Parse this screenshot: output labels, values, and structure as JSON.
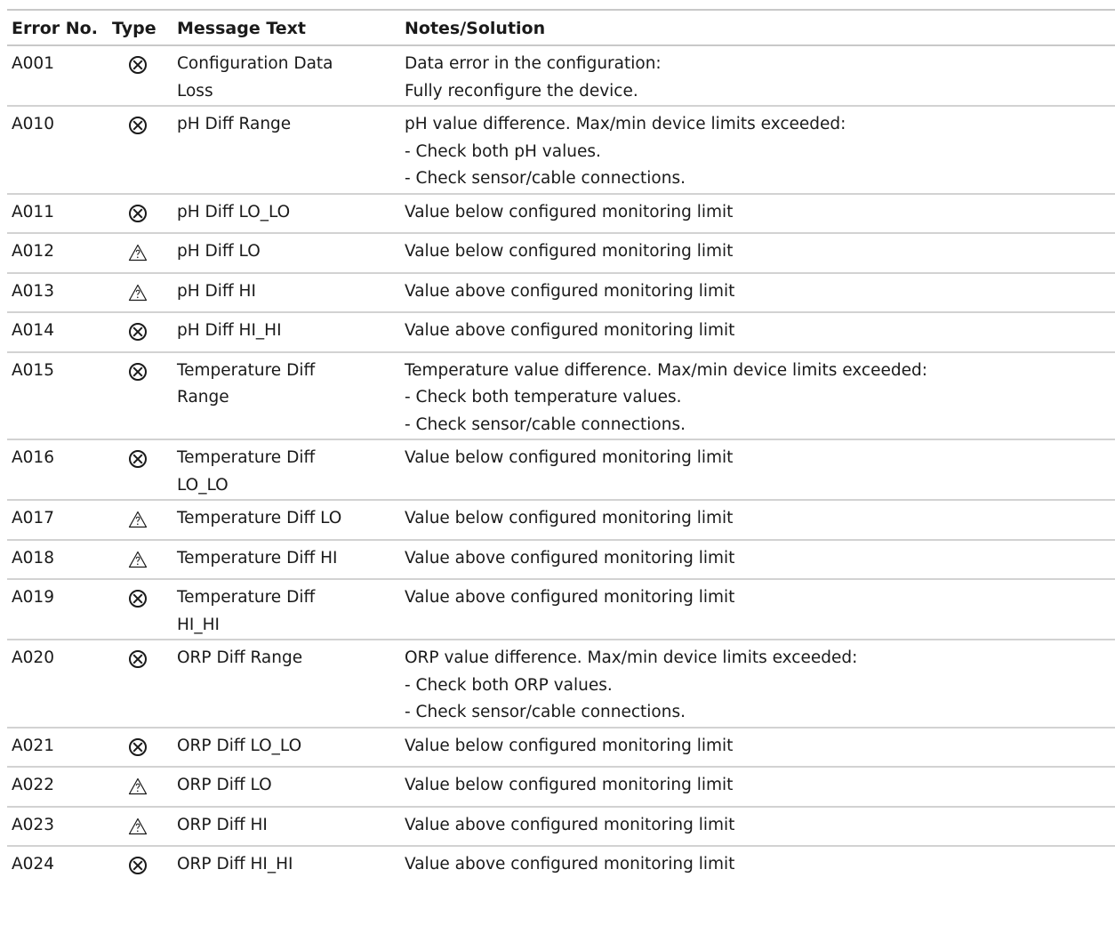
{
  "table": {
    "headers": {
      "error_no": "Error No.",
      "type": "Type",
      "message": "Message Text",
      "notes": "Notes/Solution"
    },
    "rows": [
      {
        "error_no": "A001",
        "type": "failure-icon",
        "message": [
          "Configuration Data",
          "Loss"
        ],
        "notes": [
          "Data error in the configuration:",
          "Fully reconfigure the device."
        ]
      },
      {
        "error_no": "A010",
        "type": "failure-icon",
        "message": [
          "pH Diff Range"
        ],
        "notes": [
          "pH value difference. Max/min device limits exceeded:",
          "- Check both pH values.",
          "- Check sensor/cable connections."
        ]
      },
      {
        "error_no": "A011",
        "type": "failure-icon",
        "message": [
          "pH Diff LO_LO"
        ],
        "notes": [
          "Value below configured monitoring limit"
        ]
      },
      {
        "error_no": "A012",
        "type": "warning-icon",
        "message": [
          "pH Diff LO"
        ],
        "notes": [
          "Value below configured monitoring limit"
        ]
      },
      {
        "error_no": "A013",
        "type": "warning-icon",
        "message": [
          "pH Diff HI"
        ],
        "notes": [
          "Value above configured monitoring limit"
        ]
      },
      {
        "error_no": "A014",
        "type": "failure-icon",
        "message": [
          "pH Diff HI_HI"
        ],
        "notes": [
          "Value above configured monitoring limit"
        ]
      },
      {
        "error_no": "A015",
        "type": "failure-icon",
        "message": [
          "Temperature Diff",
          "Range"
        ],
        "notes": [
          "Temperature value difference. Max/min device limits exceeded:",
          "- Check both temperature values.",
          "- Check sensor/cable connections."
        ]
      },
      {
        "error_no": "A016",
        "type": "failure-icon",
        "message": [
          "Temperature Diff",
          "LO_LO"
        ],
        "notes": [
          "Value below configured monitoring limit"
        ]
      },
      {
        "error_no": "A017",
        "type": "warning-icon",
        "message": [
          "Temperature Diff LO"
        ],
        "notes": [
          "Value below configured monitoring limit"
        ]
      },
      {
        "error_no": "A018",
        "type": "warning-icon",
        "message": [
          "Temperature Diff HI"
        ],
        "notes": [
          "Value above configured monitoring limit"
        ]
      },
      {
        "error_no": "A019",
        "type": "failure-icon",
        "message": [
          "Temperature Diff",
          "HI_HI"
        ],
        "notes": [
          "Value above configured monitoring limit"
        ]
      },
      {
        "error_no": "A020",
        "type": "failure-icon",
        "message": [
          "ORP Diff Range"
        ],
        "notes": [
          "ORP value difference. Max/min device limits exceeded:",
          "- Check both ORP values.",
          "- Check sensor/cable connections."
        ]
      },
      {
        "error_no": "A021",
        "type": "failure-icon",
        "message": [
          "ORP Diff LO_LO"
        ],
        "notes": [
          "Value below configured monitoring limit"
        ]
      },
      {
        "error_no": "A022",
        "type": "warning-icon",
        "message": [
          "ORP Diff LO"
        ],
        "notes": [
          "Value below configured monitoring limit"
        ]
      },
      {
        "error_no": "A023",
        "type": "warning-icon",
        "message": [
          "ORP Diff HI"
        ],
        "notes": [
          "Value above configured monitoring limit"
        ]
      },
      {
        "error_no": "A024",
        "type": "failure-icon",
        "message": [
          "ORP Diff HI_HI"
        ],
        "notes": [
          "Value above configured monitoring limit"
        ]
      }
    ]
  }
}
